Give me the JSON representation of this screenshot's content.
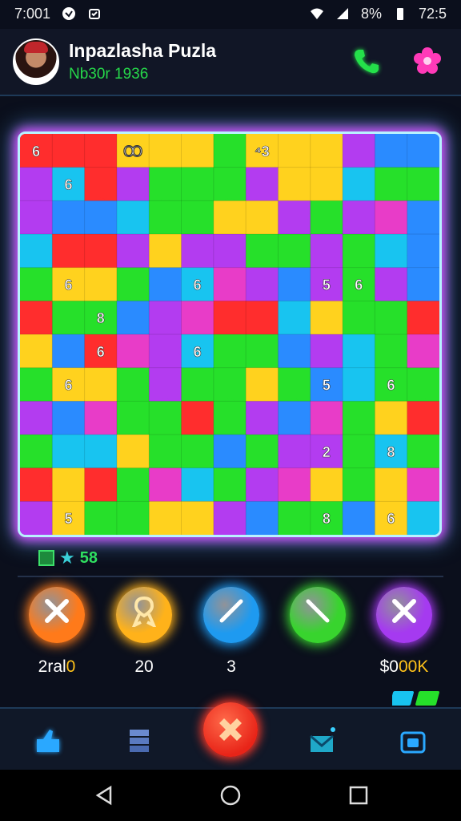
{
  "status_bar": {
    "left_text": "7:001",
    "battery": "8%",
    "time": "72:5"
  },
  "header": {
    "title": "Inpazlasha Puzla",
    "subtitle": "Nb30r 1936"
  },
  "board": {
    "cols": 13,
    "rows": 12,
    "palette": {
      "r": "#ff2d2d",
      "o": "#ff8a1e",
      "y": "#ffd21e",
      "g": "#26e02a",
      "l": "#7cf23a",
      "b": "#2a8bff",
      "c": "#18c4f0",
      "p": "#b33cf0",
      "m": "#e83cc8"
    },
    "grid": [
      "rrryyygyyypbbc",
      "pcrpgggpyycgg",
      "pbbcggyypgpmb",
      "crrpyppggpgcb",
      "gyygbcmpbpgpb",
      "rggbpmrrcyggr",
      "ybrmpcggbpcgm",
      "gyygpggygbcgg",
      "pbmggrgpbmgyr",
      "gccyggbgppgcg",
      "ryrgmcgpmygym",
      "pyggyypbggbyc"
    ],
    "numbers": [
      {
        "r": 0,
        "c": 0,
        "t": "6"
      },
      {
        "r": 0,
        "c": 3,
        "t": "Ꝏ"
      },
      {
        "r": 0,
        "c": 7,
        "t": "⁴3"
      },
      {
        "r": 1,
        "c": 1,
        "t": "6"
      },
      {
        "r": 4,
        "c": 1,
        "t": "6"
      },
      {
        "r": 4,
        "c": 5,
        "t": "6"
      },
      {
        "r": 4,
        "c": 9,
        "t": "5"
      },
      {
        "r": 4,
        "c": 10,
        "t": "6"
      },
      {
        "r": 5,
        "c": 2,
        "t": "8"
      },
      {
        "r": 6,
        "c": 2,
        "t": "6"
      },
      {
        "r": 6,
        "c": 5,
        "t": "6"
      },
      {
        "r": 7,
        "c": 1,
        "t": "6"
      },
      {
        "r": 7,
        "c": 9,
        "t": "5"
      },
      {
        "r": 7,
        "c": 11,
        "t": "6"
      },
      {
        "r": 9,
        "c": 9,
        "t": "2"
      },
      {
        "r": 9,
        "c": 11,
        "t": "8"
      },
      {
        "r": 11,
        "c": 1,
        "t": "5"
      },
      {
        "r": 11,
        "c": 9,
        "t": "8"
      },
      {
        "r": 11,
        "c": 11,
        "t": "6"
      }
    ]
  },
  "score": {
    "value": "58"
  },
  "tools": [
    {
      "name": "tool-cancel-orange",
      "label_prefix": "2ral",
      "label_highlight": "0",
      "color": "#ff7a1a",
      "glyph": "✕"
    },
    {
      "name": "tool-ribbon-gold",
      "label_prefix": "20",
      "label_highlight": "",
      "color": "#ffb21a",
      "glyph": "ribbon"
    },
    {
      "name": "tool-slash-blue",
      "label_prefix": "3",
      "label_highlight": "",
      "color": "#1e9af0",
      "glyph": "slash"
    },
    {
      "name": "tool-slash-green",
      "label_prefix": "",
      "label_highlight": "",
      "color": "#38d42e",
      "glyph": "backslash"
    },
    {
      "name": "tool-cancel-purple",
      "label_prefix": "$0",
      "label_highlight": "00K",
      "color": "#a53af0",
      "glyph": "✕"
    }
  ],
  "icons": {
    "call": "phone-icon",
    "settings": "flower-icon",
    "home": "home-icon",
    "library": "stack-icon",
    "center": "puzzle-piece-icon",
    "mail": "mail-icon",
    "camera": "camera-icon"
  }
}
